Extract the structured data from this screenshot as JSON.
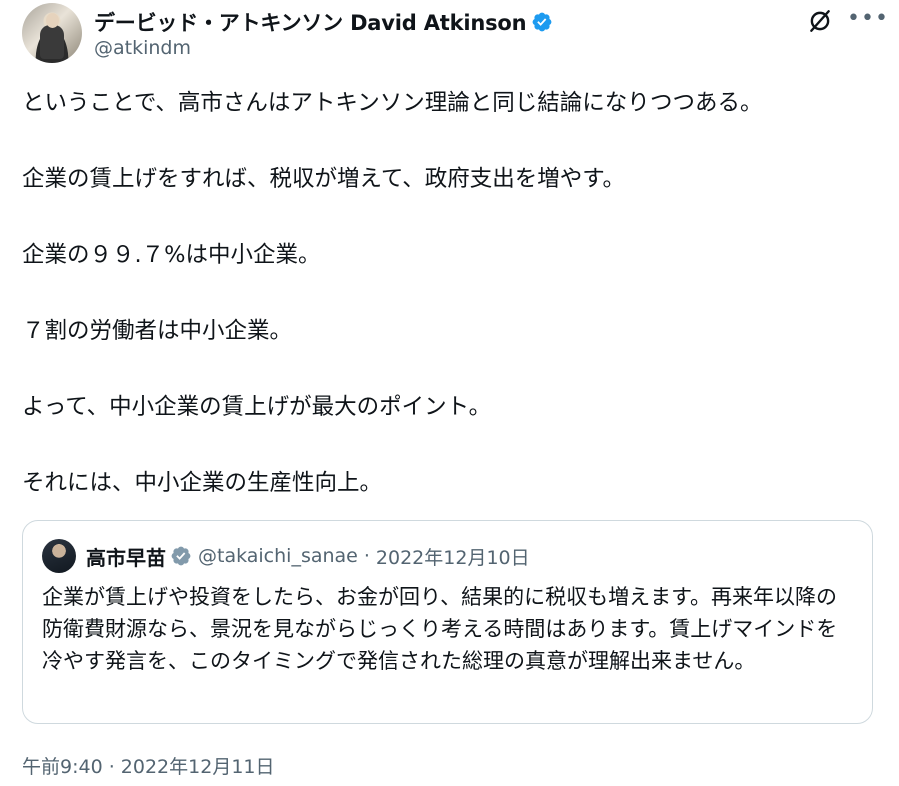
{
  "author": {
    "display_name": "デービッド・アトキンソン David Atkinson",
    "handle": "@atkindm"
  },
  "tweet": {
    "paragraphs": [
      "ということで、高市さんはアトキンソン理論と同じ結論になりつつある。",
      "企業の賃上げをすれば、税収が増えて、政府支出を増やす。",
      "企業の９９.７%は中小企業。",
      "７割の労働者は中小企業。",
      "よって、中小企業の賃上げが最大のポイント。",
      "それには、中小企業の生産性向上。"
    ],
    "timestamp": "午前9:40 · 2022年12月11日"
  },
  "quote": {
    "display_name": "高市早苗",
    "handle": "@takaichi_sanae",
    "separator": "·",
    "date": "2022年12月10日",
    "text": "企業が賃上げや投資をしたら、お金が回り、結果的に税収も増えます。再来年以降の防衛費財源なら、景況を見ながらじっくり考える時間はあります。賃上げマインドを冷やす発言を、このタイミングで発信された総理の真意が理解出来ません。"
  },
  "icons": {
    "author_verified": "verified-badge-icon",
    "quote_verified": "verified-badge-icon",
    "grok": "grok-icon",
    "more": "more-icon"
  },
  "colors": {
    "verified_blue": "#1d9bf0",
    "verified_grey": "#829aab",
    "secondary_text": "#536471",
    "border": "#cfd9de"
  }
}
